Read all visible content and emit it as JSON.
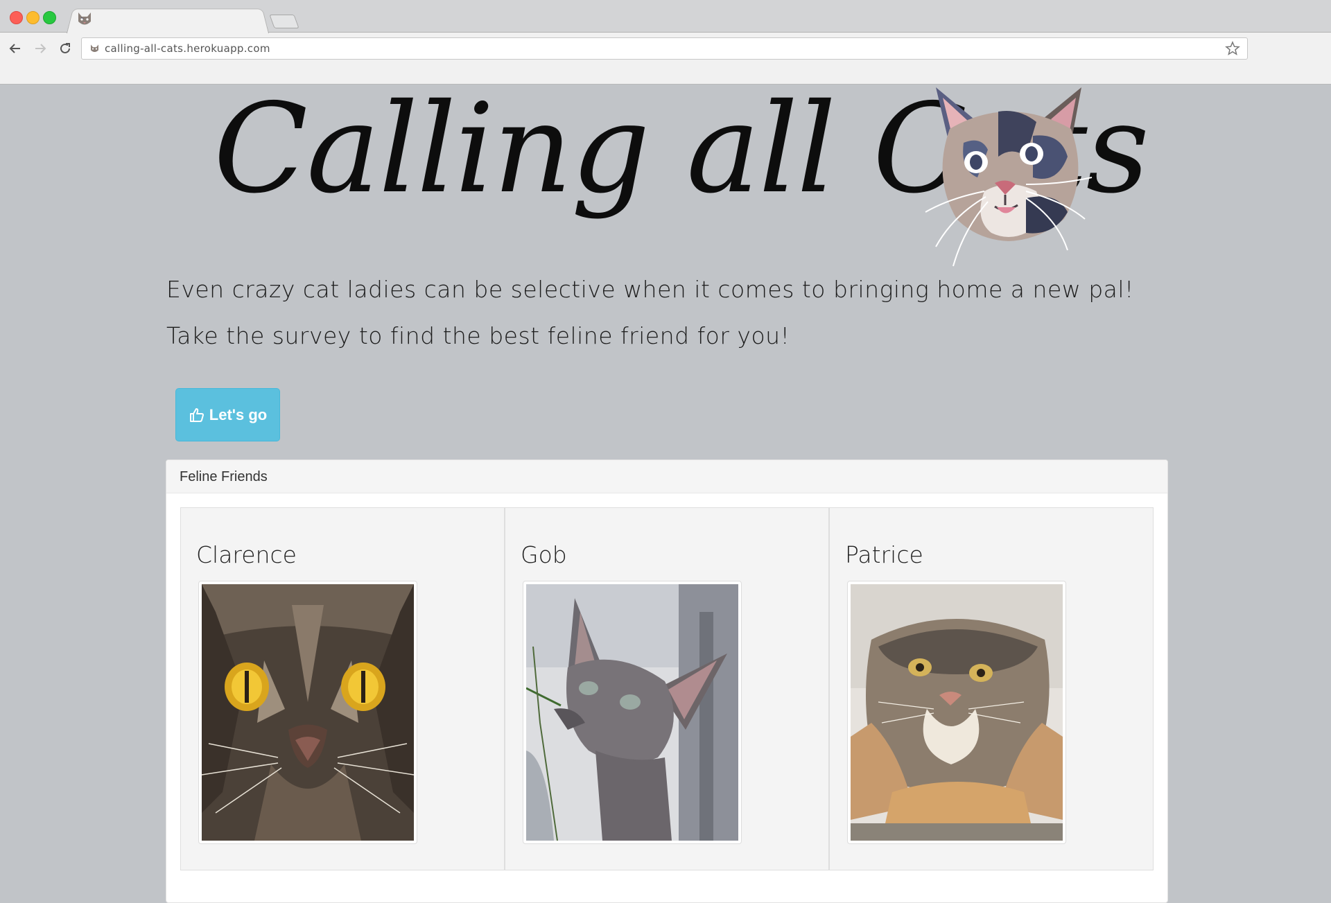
{
  "browser": {
    "url": "calling-all-cats.herokuapp.com",
    "icons": {
      "back": "arrow-left-icon",
      "forward": "arrow-right-icon",
      "reload": "reload-icon",
      "bookmark": "star-icon"
    }
  },
  "hero": {
    "title": "Calling all Cats",
    "tagline_1": "Even crazy cat ladies can be selective when it comes to bringing home a new pal!",
    "tagline_2": "Take the survey to find the best feline friend for you!"
  },
  "cta": {
    "label": "Let's go",
    "icon": "thumbs-up-icon",
    "color": "#5bc0de"
  },
  "friends_panel": {
    "heading": "Feline Friends",
    "cats": [
      {
        "name": "Clarence"
      },
      {
        "name": "Gob"
      },
      {
        "name": "Patrice"
      }
    ]
  },
  "colors": {
    "page_bg": "#c1c4c8",
    "button": "#5bc0de"
  }
}
